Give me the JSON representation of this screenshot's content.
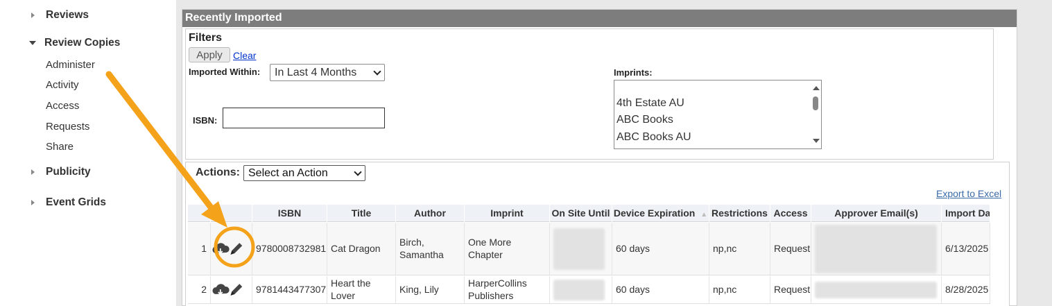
{
  "sidebar": {
    "reviews": "Reviews",
    "review_copies": "Review Copies",
    "sub_items": [
      "Administer",
      "Activity",
      "Access",
      "Requests",
      "Share"
    ],
    "publicity": "Publicity",
    "event_grids": "Event Grids"
  },
  "panel": {
    "title": "Recently Imported"
  },
  "filters": {
    "title": "Filters",
    "apply_label": "Apply",
    "clear_label": "Clear",
    "imported_within_label": "Imported Within:",
    "imported_within_value": "In Last 4 Months",
    "isbn_label": "ISBN:",
    "isbn_value": "",
    "imprints_label": "Imprints:",
    "imprints_options": [
      "4th Estate AU",
      "ABC Books",
      "ABC Books AU"
    ]
  },
  "actions": {
    "label": "Actions:",
    "select_value": "Select an Action",
    "export_label": "Export to Excel"
  },
  "table": {
    "columns": [
      "",
      "",
      "ISBN",
      "Title",
      "Author",
      "Imprint",
      "On Site Until",
      "Device Expiration",
      "Restrictions",
      "Access",
      "Approver Email(s)",
      "Import Dat"
    ],
    "rows": [
      {
        "num": "1",
        "isbn": "9780008732981",
        "title": "Cat Dragon",
        "author": "Birch, Samantha",
        "imprint": "One More Chapter",
        "device_expiration": "60 days",
        "restrictions": "np,nc",
        "access": "Request",
        "import_date": "6/13/2025"
      },
      {
        "num": "2",
        "isbn": "9781443477307",
        "title": "Heart the Lover",
        "author": "King, Lily",
        "imprint": "HarperCollins Publishers",
        "device_expiration": "60 days",
        "restrictions": "np,nc",
        "access": "Request",
        "import_date": "8/28/2025"
      }
    ]
  },
  "colors": {
    "header_bg": "#7d7d7d",
    "annotation": "#f5a21b",
    "link": "#0033cc"
  }
}
